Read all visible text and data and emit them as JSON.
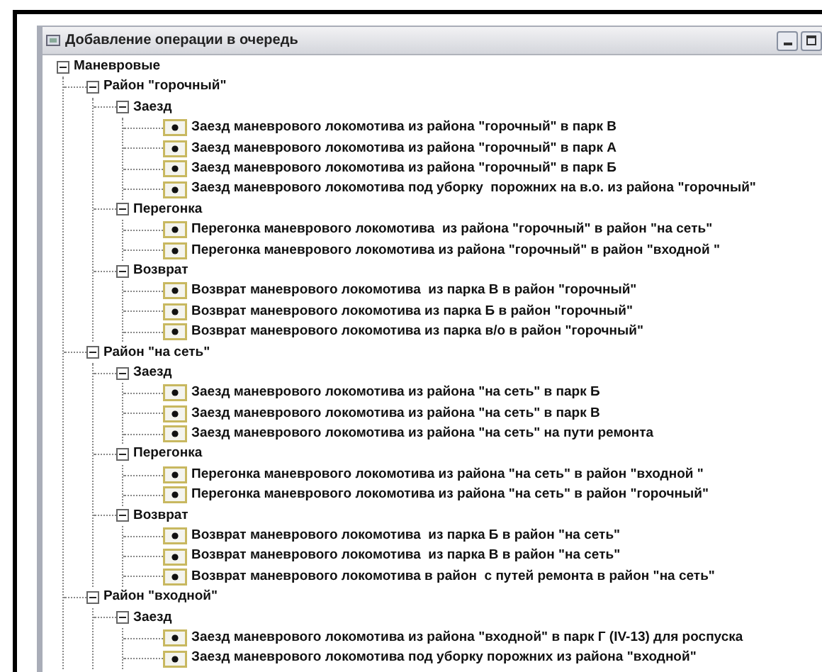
{
  "window": {
    "title": "Добавление операции в очередь"
  },
  "tree": [
    {
      "label": "Маневровые",
      "expanded": true,
      "children": [
        {
          "label": "Район \"горочный\"",
          "expanded": true,
          "children": [
            {
              "label": "Заезд",
              "expanded": true,
              "children": [
                {
                  "label": "Заезд маневрового локомотива из района \"горочный\" в парк В"
                },
                {
                  "label": "Заезд маневрового локомотива из района \"горочный\" в парк А"
                },
                {
                  "label": "Заезд маневрового локомотива из района \"горочный\" в парк Б"
                },
                {
                  "label": "Заезд маневрового локомотива под уборку  порожних на в.о. из района \"горочный\""
                }
              ]
            },
            {
              "label": "Перегонка",
              "expanded": true,
              "children": [
                {
                  "label": "Перегонка маневрового локомотива  из района \"горочный\" в район \"на сеть\""
                },
                {
                  "label": "Перегонка маневрового локомотива из района \"горочный\" в район \"входной \""
                }
              ]
            },
            {
              "label": "Возврат",
              "expanded": true,
              "children": [
                {
                  "label": "Возврат маневрового локомотива  из парка В в район \"горочный\""
                },
                {
                  "label": "Возврат маневрового локомотива из парка Б в район \"горочный\""
                },
                {
                  "label": "Возврат маневрового локомотива из парка в/о в район \"горочный\""
                }
              ]
            }
          ]
        },
        {
          "label": "Район \"на сеть\"",
          "expanded": true,
          "children": [
            {
              "label": "Заезд",
              "expanded": true,
              "children": [
                {
                  "label": "Заезд маневрового локомотива из района \"на сеть\" в парк Б"
                },
                {
                  "label": "Заезд маневрового локомотива из района \"на сеть\" в парк В"
                },
                {
                  "label": "Заезд маневрового локомотива из района \"на сеть\" на пути ремонта"
                }
              ]
            },
            {
              "label": "Перегонка",
              "expanded": true,
              "children": [
                {
                  "label": "Перегонка маневрового локомотива из района \"на сеть\" в район \"входной \""
                },
                {
                  "label": "Перегонка маневрового локомотива из района \"на сеть\" в район \"горочный\""
                }
              ]
            },
            {
              "label": "Возврат",
              "expanded": true,
              "children": [
                {
                  "label": "Возврат маневрового локомотива  из парка Б в район \"на сеть\""
                },
                {
                  "label": "Возврат маневрового локомотива  из парка В в район \"на сеть\""
                },
                {
                  "label": "Возврат маневрового локомотива в район  с путей ремонта в район \"на сеть\""
                }
              ]
            }
          ]
        },
        {
          "label": "Район \"входной\"",
          "expanded": true,
          "children": [
            {
              "label": "Заезд",
              "expanded": true,
              "children": [
                {
                  "label": "Заезд маневрового локомотива из района \"входной\" в парк Г (IV-13) для роспуска"
                },
                {
                  "label": "Заезд маневрового локомотива под уборку порожних из района \"входной\""
                }
              ]
            }
          ]
        }
      ]
    }
  ]
}
